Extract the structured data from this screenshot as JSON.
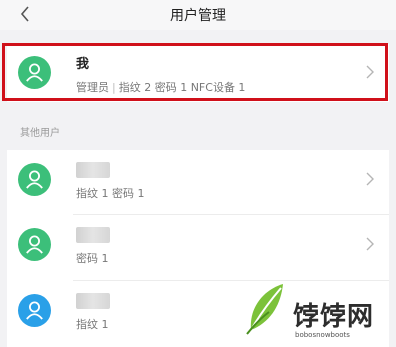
{
  "header": {
    "title": "用户管理",
    "back_icon": "chevron-left-icon"
  },
  "owner": {
    "name": "我",
    "role": "管理员",
    "separator": "|",
    "summary": "指纹 2  密码 1  NFC设备 1"
  },
  "section_label": "其他用户",
  "users": [
    {
      "details": "指纹 1  密码 1",
      "avatar_color": "#3cbf7a"
    },
    {
      "details": "密码 1",
      "avatar_color": "#3cbf7a"
    },
    {
      "details": "指纹 1",
      "avatar_color": "#2aa0e8"
    }
  ],
  "colors": {
    "avatar_green": "#3cbf7a",
    "avatar_blue": "#2aa0e8",
    "highlight_red": "#d0101a"
  },
  "watermark": {
    "text": "饽饽网",
    "subtext": "bobosnowboots"
  }
}
